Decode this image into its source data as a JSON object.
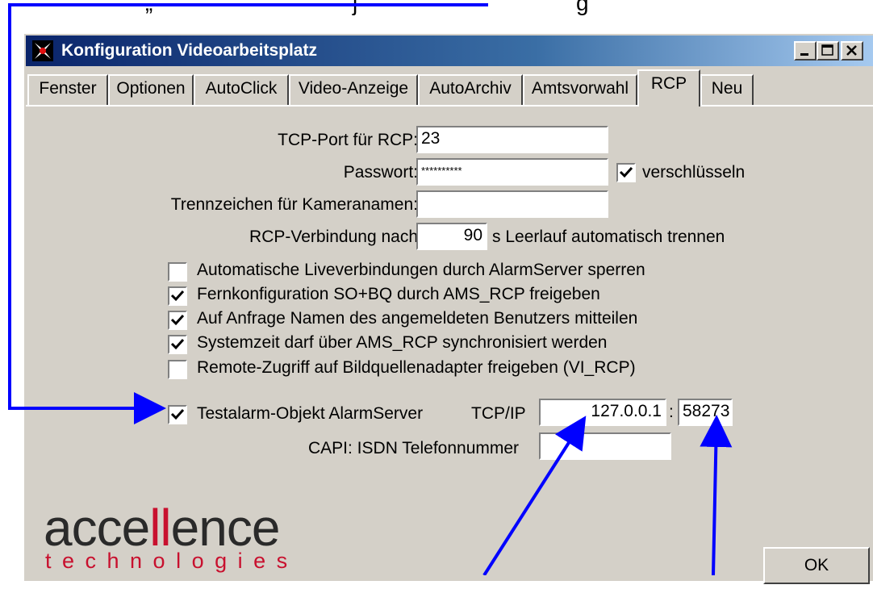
{
  "top_fragments": [
    "„",
    "j",
    "g"
  ],
  "window": {
    "title": "Konfiguration Videoarbeitsplatz",
    "controls": [
      "minimize",
      "maximize",
      "close"
    ]
  },
  "tabs": [
    "Fenster",
    "Optionen",
    "AutoClick",
    "Video-Anzeige",
    "AutoArchiv",
    "Amtsvorwahl",
    "RCP",
    "Neu"
  ],
  "active_tab": "RCP",
  "form": {
    "tcp_port_label": "TCP-Port für RCP:",
    "tcp_port_value": "23",
    "password_label": "Passwort:",
    "password_value": "**********",
    "encrypt_label": "verschlüsseln",
    "encrypt_checked": true,
    "separator_label": "Trennzeichen für Kameranamen:",
    "separator_value": "",
    "rcp_connection_label": "RCP-Verbindung nach",
    "rcp_timeout_value": "90",
    "rcp_timeout_suffix": "s Leerlauf automatisch trennen"
  },
  "checkboxes": [
    {
      "label": "Automatische Liveverbindungen durch AlarmServer sperren",
      "checked": false
    },
    {
      "label": "Fernkonfiguration SO+BQ durch AMS_RCP freigeben",
      "checked": true
    },
    {
      "label": "Auf Anfrage Namen des angemeldeten Benutzers mitteilen",
      "checked": true
    },
    {
      "label": "Systemzeit darf über AMS_RCP synchronisiert werden",
      "checked": true
    },
    {
      "label": "Remote-Zugriff auf Bildquellenadapter freigeben (VI_RCP)",
      "checked": false
    }
  ],
  "testalarm": {
    "label": "Testalarm-Objekt AlarmServer",
    "checked": true,
    "tcpip_label": "TCP/IP",
    "ip_value": "127.0.0.1",
    "colon": ":",
    "port_value": "58273",
    "capi_label": "CAPI: ISDN Telefonnummer",
    "capi_value": ""
  },
  "logo": {
    "word": "accellence",
    "word_a": "acce",
    "word_b": "ll",
    "word_c": "ence",
    "sub": "technologies"
  },
  "ok_button": "OK",
  "colors": {
    "annotation": "#0000ff",
    "logo_red": "#c8102e",
    "title_bar": "#0a246a",
    "dialog_bg": "#d4d0c8"
  }
}
